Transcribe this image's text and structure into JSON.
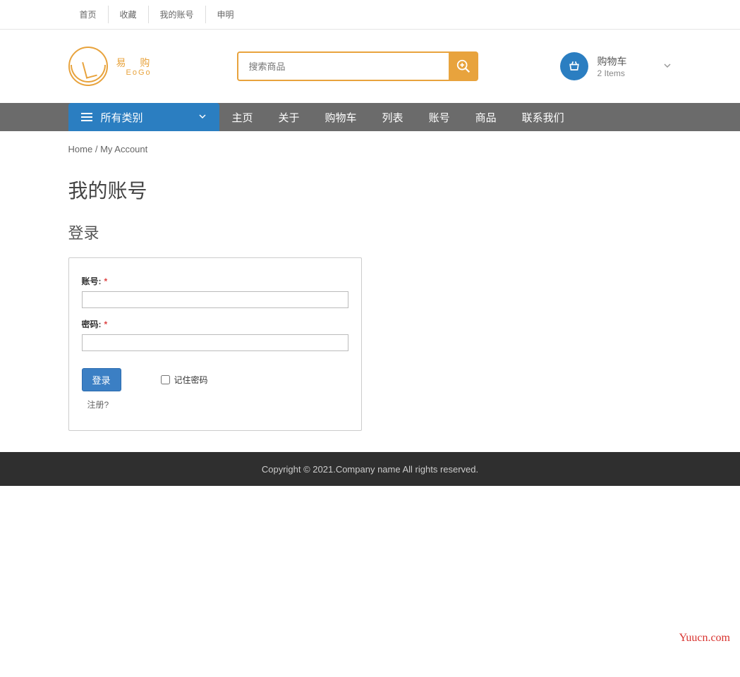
{
  "topbar": {
    "links": [
      "首页",
      "收藏",
      "我的账号",
      "申明"
    ]
  },
  "logo": {
    "cn": "易 购",
    "en": "EoGo"
  },
  "search": {
    "placeholder": "搜索商品"
  },
  "cart": {
    "label": "购物车",
    "count": "2 Items"
  },
  "categories": {
    "label": "所有类别"
  },
  "nav": {
    "items": [
      "主页",
      "关于",
      "购物车",
      "列表",
      "账号",
      "商品",
      "联系我们"
    ]
  },
  "breadcrumb": {
    "home": "Home",
    "sep": "/",
    "current": "My Account"
  },
  "page": {
    "title": "我的账号",
    "section": "登录"
  },
  "form": {
    "username_label": "账号:",
    "password_label": "密码:",
    "required": "*",
    "login_btn": "登录",
    "remember": "记住密码",
    "register": "注册?"
  },
  "footer": {
    "text": "Copyright © 2021.Company name All rights reserved."
  },
  "watermark": "Yuucn.com"
}
